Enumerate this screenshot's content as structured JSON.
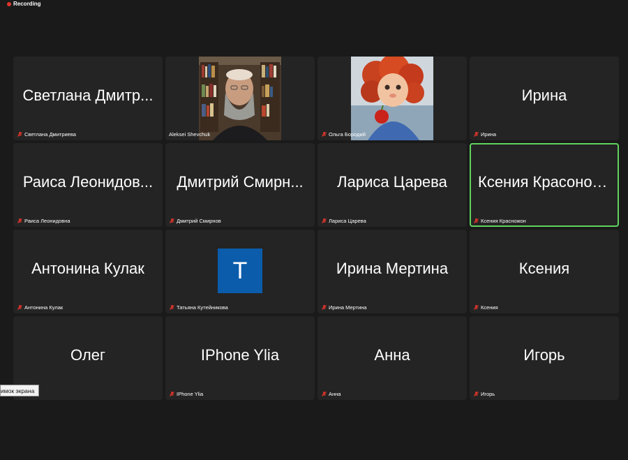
{
  "status": {
    "recording": "Recording"
  },
  "tiles": [
    {
      "display": "Светлана Дмитр...",
      "label": "Светлана Дмитриева"
    },
    {
      "display": "",
      "label": "Aleksei Shevchuk"
    },
    {
      "display": "",
      "label": "Ольга Бородий"
    },
    {
      "display": "Ирина",
      "label": "Ирина"
    },
    {
      "display": "Раиса Леонидов...",
      "label": "Раиса Леонидовна"
    },
    {
      "display": "Дмитрий Смирн...",
      "label": "Дмитрий Смирнов"
    },
    {
      "display": "Лариса Царева",
      "label": "Лариса Царева"
    },
    {
      "display": "Ксения Красонож...",
      "label": "Ксения Красножон"
    },
    {
      "display": "Антонина Кулак",
      "label": "Антонина Кулак"
    },
    {
      "display": "T",
      "label": "Татьяна Кутейникова"
    },
    {
      "display": "Ирина Мертина",
      "label": "Ирина Мертина"
    },
    {
      "display": "Ксения",
      "label": "Ксения"
    },
    {
      "display": "Олег",
      "label": ""
    },
    {
      "display": "IPhone Ylia",
      "label": "IPhone Ylia"
    },
    {
      "display": "Анна",
      "label": "Анна"
    },
    {
      "display": "Игорь",
      "label": "Игорь"
    }
  ],
  "tooltip": {
    "text": "имок экрана"
  },
  "colors": {
    "background": "#1a1a1a",
    "tile": "#242424",
    "active_speaker_border": "#5fd35f",
    "recording_dot": "#e0352b",
    "muted_icon": "#e0352b",
    "avatar_bg": "#0b5cab"
  }
}
